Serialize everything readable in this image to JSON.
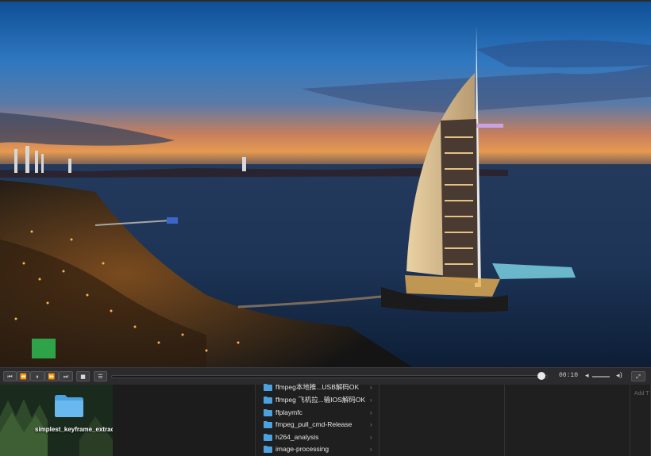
{
  "player": {
    "time": "00:10",
    "progress_fraction": 0.985,
    "buttons": {
      "skip_back": "⏮",
      "rewind": "⏪",
      "pause": "⏸",
      "forward": "⏩",
      "skip_forward": "⏭",
      "stop": "■",
      "playlist": "☰",
      "volume_down": "◂",
      "volume_up": "◂)",
      "fullscreen": "⤢"
    }
  },
  "desktop": {
    "folder_label": "simplest_keyframe_extractor"
  },
  "finder": {
    "items": [
      {
        "label": "ffmpeg本地推...USB解码OK"
      },
      {
        "label": "ffmpeg 飞机拉...输IOS解码OK"
      },
      {
        "label": "ffplaymfc"
      },
      {
        "label": "fmpeg_pull_cmd-Release"
      },
      {
        "label": "h264_analysis"
      },
      {
        "label": "image-processing"
      }
    ],
    "chevron": "›",
    "add_tags": "Add T"
  },
  "colors": {
    "folder": "#4aa3e0",
    "accent": "#ffffff"
  }
}
